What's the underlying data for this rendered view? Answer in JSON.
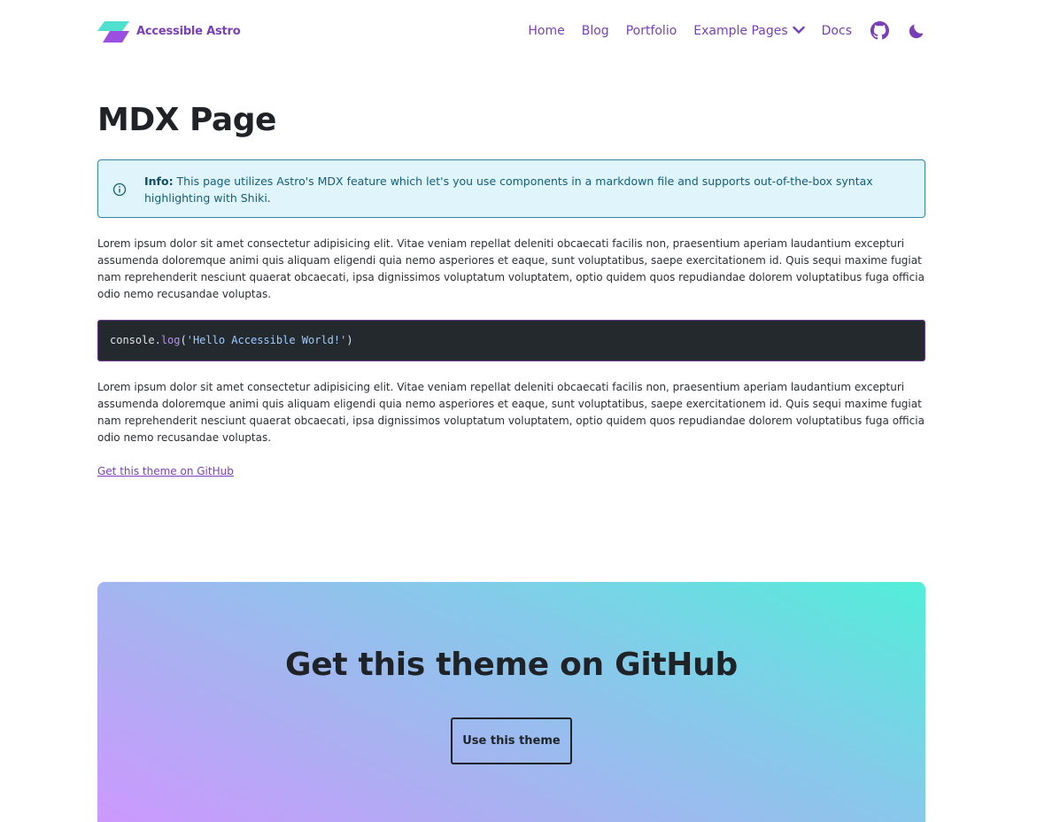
{
  "header": {
    "logo_text": "Accessible Astro",
    "nav": {
      "home": "Home",
      "blog": "Blog",
      "portfolio": "Portfolio",
      "example_pages": "Example Pages",
      "docs": "Docs"
    },
    "icons": [
      "github-icon",
      "moon-icon"
    ]
  },
  "main": {
    "title": "MDX Page",
    "notice": {
      "label": "Info:",
      "text": " This page utilizes Astro's MDX feature which let's you use components in a markdown file and supports out-of-the-box syntax highlighting with Shiki."
    },
    "paragraph_1": "Lorem ipsum dolor sit amet consectetur adipisicing elit. Vitae veniam repellat deleniti obcaecati facilis non, praesentium aperiam laudantium excepturi assumenda doloremque animi quis aliquam eligendi quia nemo asperiores et eaque, sunt voluptatibus, saepe exercitationem id. Quis sequi maxime fugiat nam reprehenderit nesciunt quaerat obcaecati, ipsa dignissimos voluptatum voluptatem, optio quidem quos repudiandae dolorem voluptatibus fuga officia odio nemo recusandae voluptas.",
    "code": {
      "object": "console",
      "dot": ".",
      "method": "log",
      "open": "(",
      "string": "'Hello Accessible World!'",
      "close": ")"
    },
    "paragraph_2": "Lorem ipsum dolor sit amet consectetur adipisicing elit. Vitae veniam repellat deleniti obcaecati facilis non, praesentium aperiam laudantium excepturi assumenda doloremque animi quis aliquam eligendi quia nemo asperiores et eaque, sunt voluptatibus, saepe exercitationem id. Quis sequi maxime fugiat nam reprehenderit nesciunt quaerat obcaecati, ipsa dignissimos voluptatum voluptatem, optio quidem quos repudiandae dolorem voluptatibus fuga officia odio nemo recusandae voluptas.",
    "github_link": "Get this theme on GitHub"
  },
  "cta": {
    "title": "Get this theme on GitHub",
    "button": "Use this theme"
  },
  "colors": {
    "accent": "#7a3fb8",
    "notice_bg": "#dff4fb",
    "notice_border": "#2f86a8",
    "code_bg": "#24292e"
  }
}
